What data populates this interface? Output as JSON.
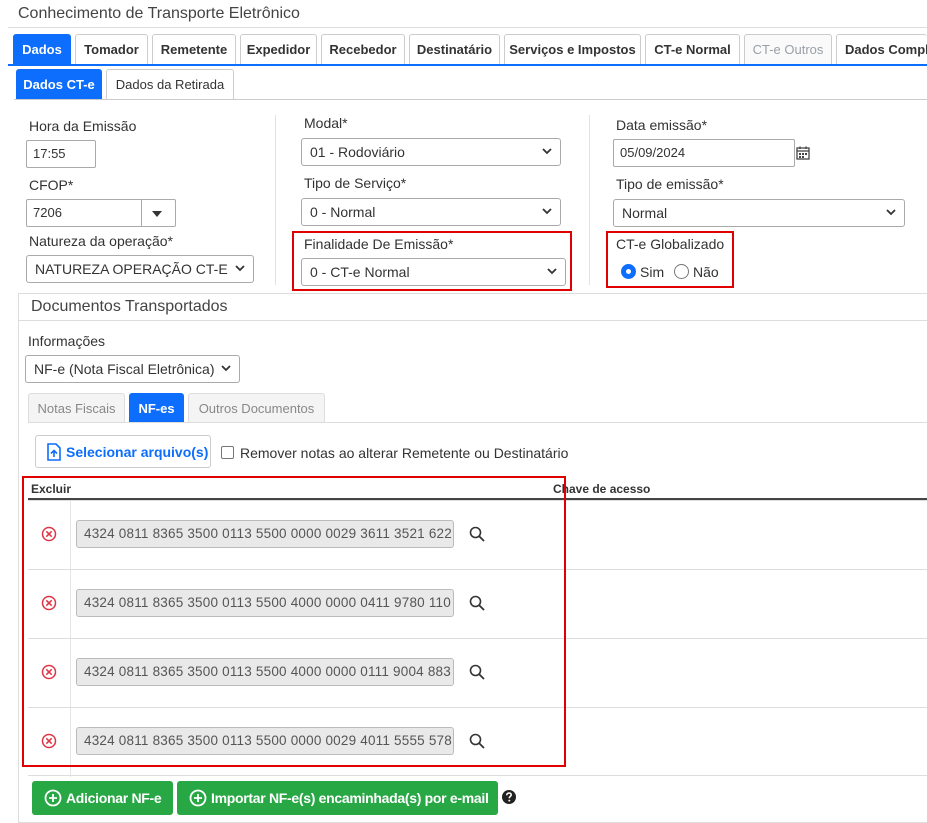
{
  "window": {
    "title": "Conhecimento de Transporte Eletrônico"
  },
  "tabs": [
    "Dados",
    "Tomador",
    "Remetente",
    "Expedidor",
    "Recebedor",
    "Destinatário",
    "Serviços e Impostos",
    "CT-e Normal",
    "CT-e Outros",
    "Dados Comple"
  ],
  "subtabs": [
    "Dados CT-e",
    "Dados da Retirada"
  ],
  "form": {
    "hora_label": "Hora da Emissão",
    "hora_value": "17:55",
    "cfop_label": "CFOP*",
    "cfop_value": "7206",
    "natureza_label": "Natureza da operação*",
    "natureza_value": "NATUREZA OPERAÇÃO CT-E",
    "modal_label": "Modal*",
    "modal_value": "01 - Rodoviário",
    "tipo_servico_label": "Tipo de Serviço*",
    "tipo_servico_value": "0 - Normal",
    "finalidade_label": "Finalidade De Emissão*",
    "finalidade_value": "0 - CT-e Normal",
    "data_label": "Data emissão*",
    "data_value": "05/09/2024",
    "tipo_emissao_label": "Tipo de emissão*",
    "tipo_emissao_value": "Normal",
    "globalizado_label": "CT-e Globalizado",
    "globalizado_options": [
      "Sim",
      "Não"
    ],
    "globalizado_selected": "Sim"
  },
  "documentos": {
    "title": "Documentos Transportados",
    "info_label": "Informações",
    "info_value": "NF-e (Nota Fiscal Eletrônica)",
    "tabs": [
      "Notas Fiscais",
      "NF-es",
      "Outros Documentos"
    ],
    "select_file_label": "Selecionar arquivo(s)",
    "remove_notes_label": "Remover notas ao alterar Remetente ou Destinatário",
    "col_excluir": "Excluir",
    "col_chave": "Chave de acesso",
    "rows": [
      {
        "key": "4324 0811 8365 3500 0113 5500 0000 0029 3611 3521 622"
      },
      {
        "key": "4324 0811 8365 3500 0113 5500 4000 0000 0411 9780 110"
      },
      {
        "key": "4324 0811 8365 3500 0113 5500 4000 0000 0111 9004 883"
      },
      {
        "key": "4324 0811 8365 3500 0113 5500 0000 0029 4011 5555 578"
      }
    ],
    "add_button": "Adicionar NF-e",
    "import_button": "Importar NF-e(s) encaminhada(s) por e-mail"
  },
  "colors": {
    "accent": "#0d6efd",
    "highlight": "#e00000",
    "success": "#28a745",
    "danger": "#dc3545"
  },
  "icons": [
    "calendar-icon",
    "caret-down-icon",
    "chevron-down-icon",
    "file-upload-icon",
    "remove-circle-icon",
    "search-icon",
    "plus-circle-icon",
    "help-icon"
  ]
}
